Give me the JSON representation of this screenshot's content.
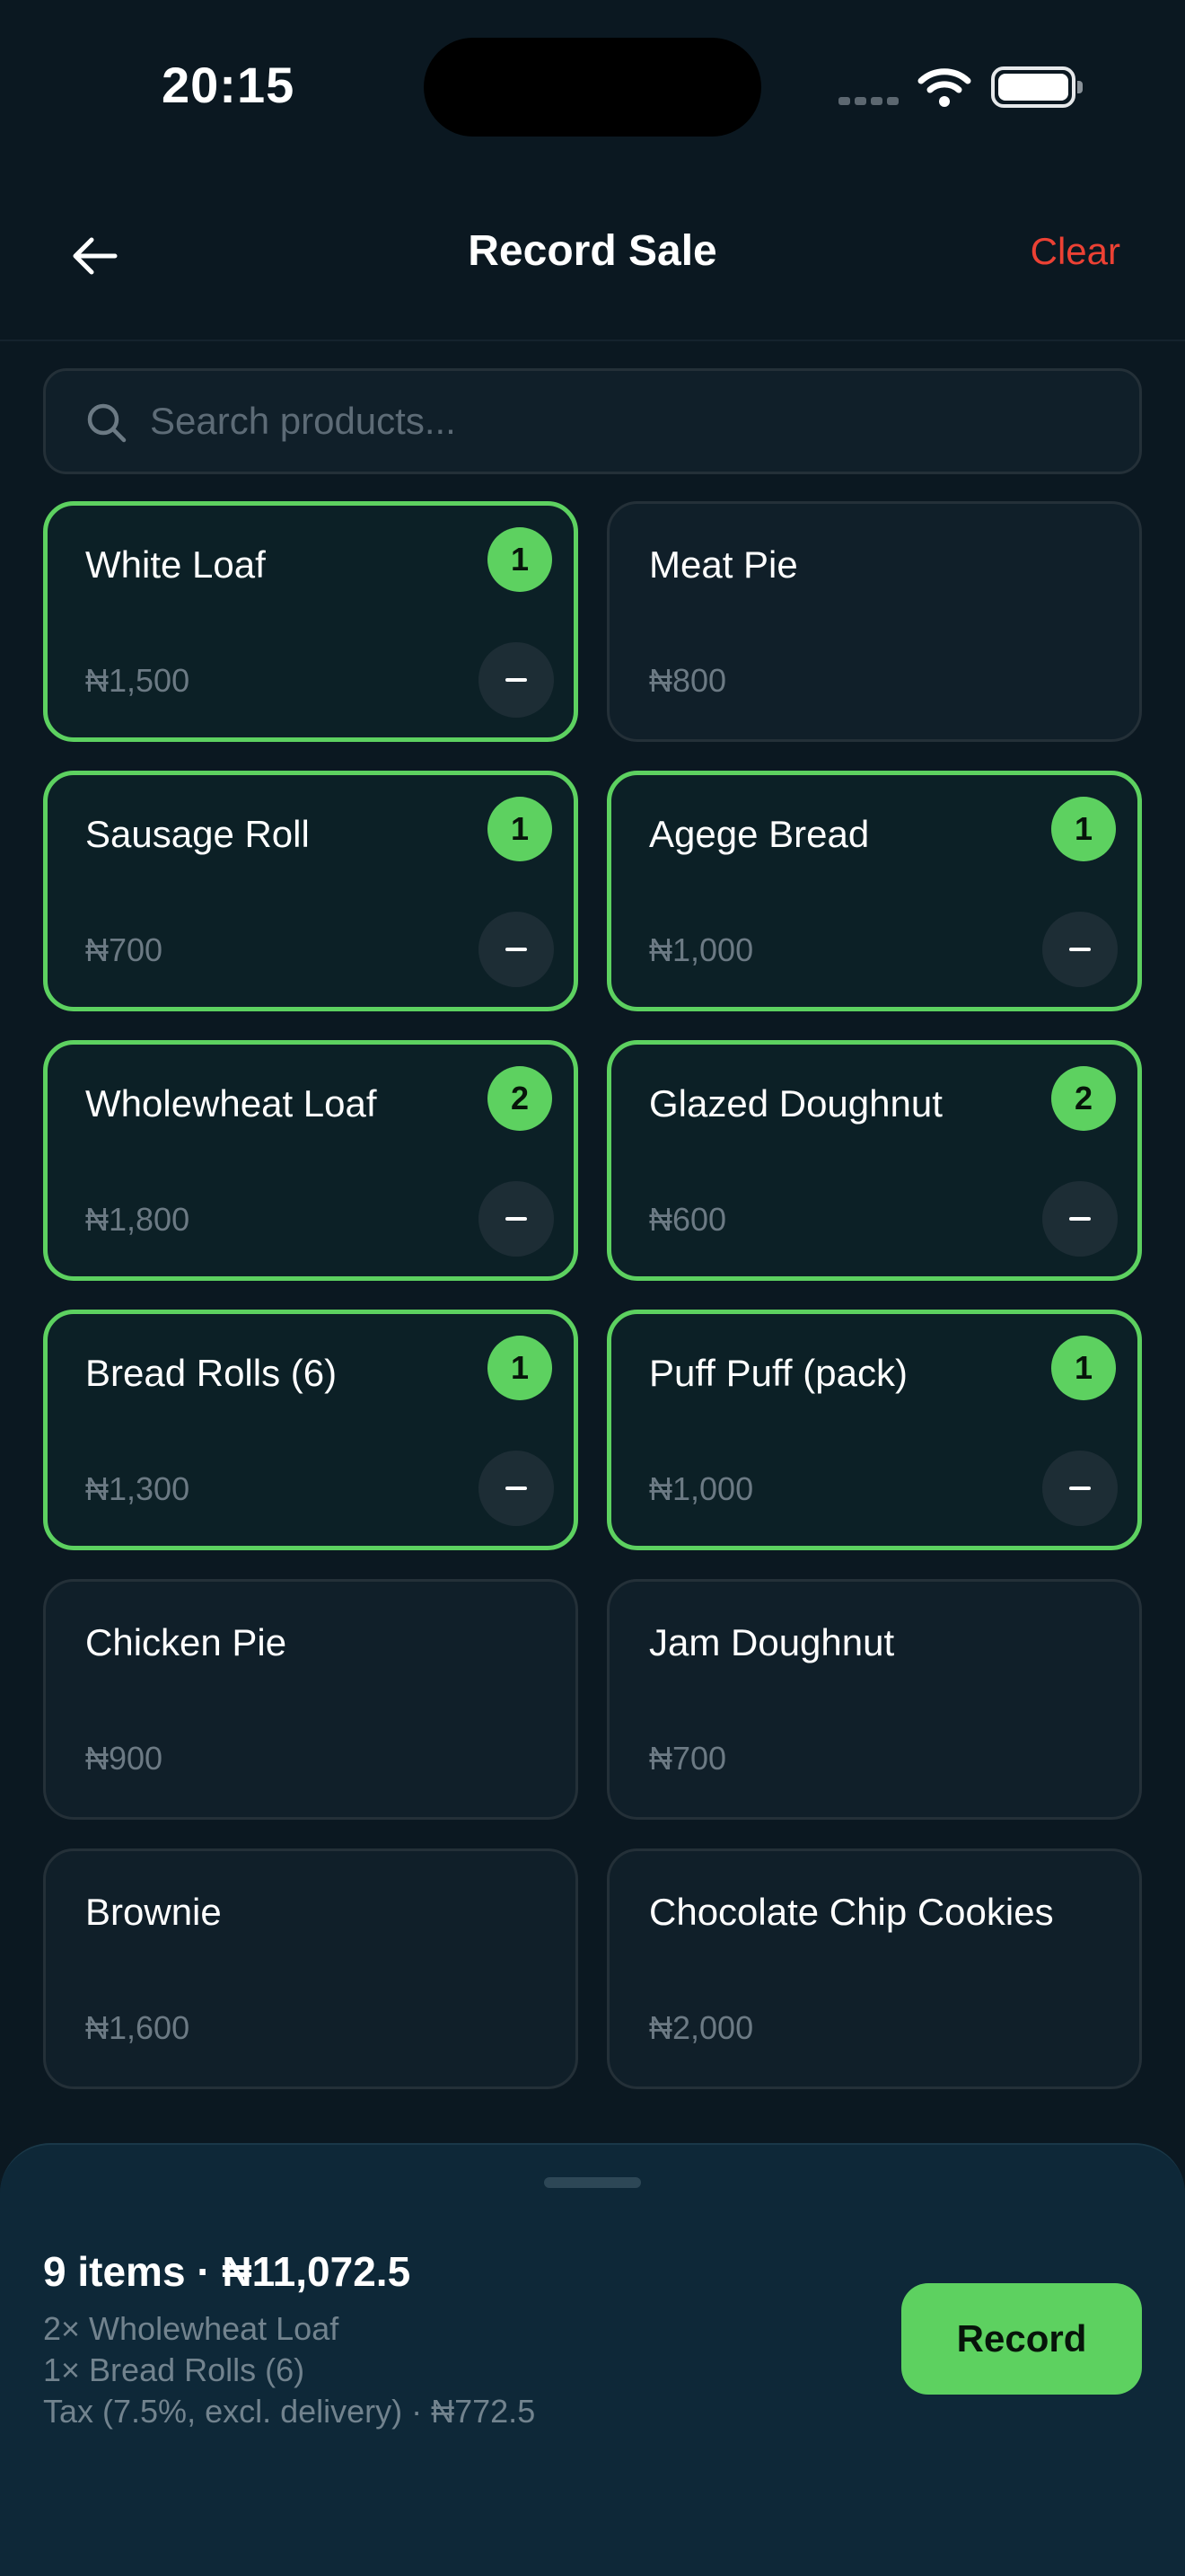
{
  "status_bar": {
    "time": "20:15"
  },
  "header": {
    "title": "Record Sale",
    "clear_label": "Clear"
  },
  "search": {
    "placeholder": "Search products..."
  },
  "products": [
    {
      "name": "White Loaf",
      "price": "₦1,500",
      "qty": "1",
      "selected": true
    },
    {
      "name": "Meat Pie",
      "price": "₦800",
      "qty": "",
      "selected": false
    },
    {
      "name": "Sausage Roll",
      "price": "₦700",
      "qty": "1",
      "selected": true
    },
    {
      "name": "Agege Bread",
      "price": "₦1,000",
      "qty": "1",
      "selected": true
    },
    {
      "name": "Wholewheat Loaf",
      "price": "₦1,800",
      "qty": "2",
      "selected": true
    },
    {
      "name": "Glazed Doughnut",
      "price": "₦600",
      "qty": "2",
      "selected": true
    },
    {
      "name": "Bread Rolls (6)",
      "price": "₦1,300",
      "qty": "1",
      "selected": true
    },
    {
      "name": "Puff Puff (pack)",
      "price": "₦1,000",
      "qty": "1",
      "selected": true
    },
    {
      "name": "Chicken Pie",
      "price": "₦900",
      "qty": "",
      "selected": false
    },
    {
      "name": "Jam Doughnut",
      "price": "₦700",
      "qty": "",
      "selected": false
    },
    {
      "name": "Brownie",
      "price": "₦1,600",
      "qty": "",
      "selected": false
    },
    {
      "name": "Chocolate Chip Cookies",
      "price": "₦2,000",
      "qty": "",
      "selected": false
    }
  ],
  "sheet": {
    "summary": "9 items · ₦11,072.5",
    "lines": [
      "2× Wholewheat Loaf",
      "1× Bread Rolls (6)",
      "Tax (7.5%, excl. delivery) · ₦772.5"
    ],
    "record_label": "Record"
  },
  "colors": {
    "accent": "#5dd160",
    "danger": "#ec4134",
    "background": "#0b1821",
    "card": "#101f29"
  }
}
